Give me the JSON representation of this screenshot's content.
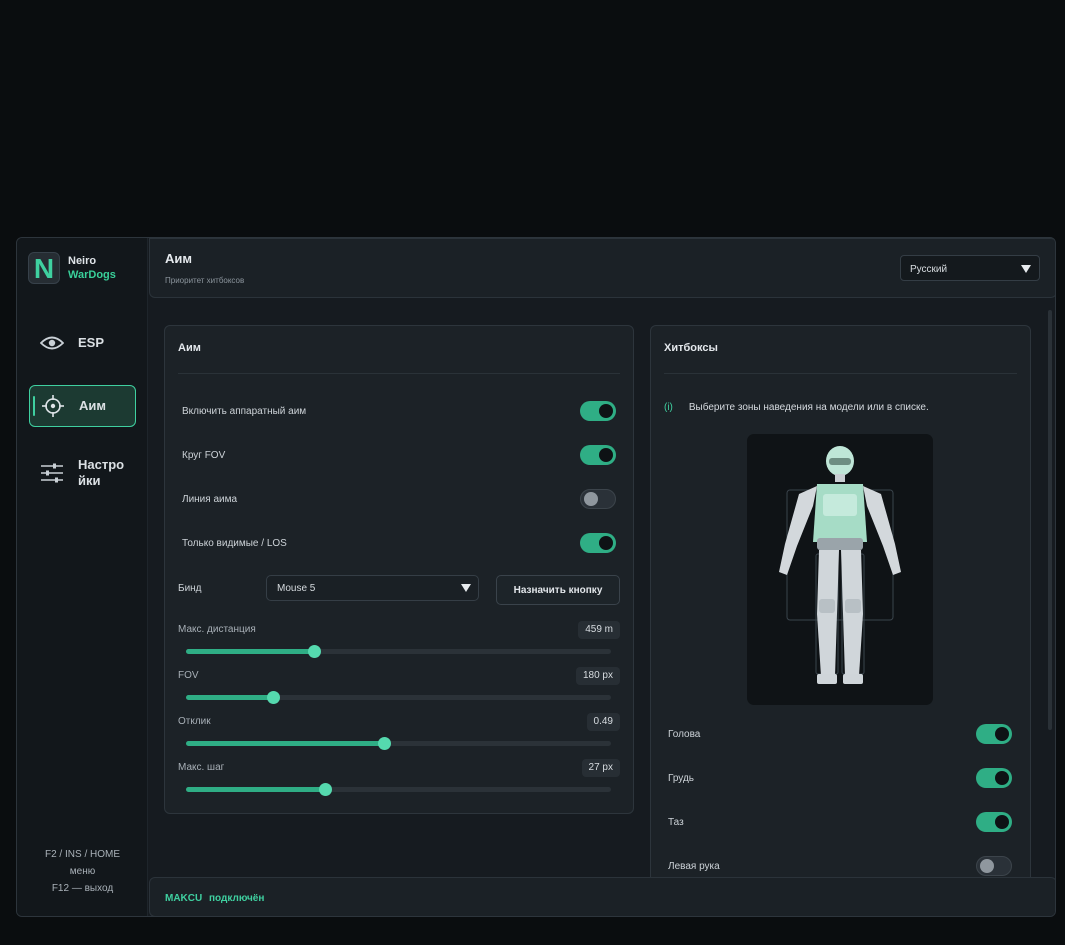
{
  "brand": {
    "logo_letter": "N",
    "line1": "Neiro",
    "line2": "WarDogs"
  },
  "sidebar": {
    "items": [
      {
        "label": "ESP",
        "icon": "eye-icon"
      },
      {
        "label": "Аим",
        "icon": "crosshair-icon",
        "active": true
      },
      {
        "label": "Настро\nйки",
        "icon": "sliders-icon"
      }
    ],
    "hotkeys": [
      "F2 / INS / HOME",
      "меню",
      "F12 — выход"
    ]
  },
  "header": {
    "title": "Аим",
    "subtitle": "Приоритет хитбоксов",
    "language": "Русский"
  },
  "aim_panel": {
    "title": "Аим",
    "toggles": [
      {
        "label": "Включить аппаратный аим",
        "on": true
      },
      {
        "label": "Круг FOV",
        "on": true
      },
      {
        "label": "Линия аима",
        "on": false
      },
      {
        "label": "Только видимые / LOS",
        "on": true
      }
    ],
    "bind": {
      "label": "Бинд",
      "value": "Mouse 5",
      "assign_button": "Назначить кнопку"
    },
    "sliders": [
      {
        "label": "Макс. дистанция",
        "value": "459 m",
        "fraction": 0.3
      },
      {
        "label": "FOV",
        "value": "180 px",
        "fraction": 0.205
      },
      {
        "label": "Отклик",
        "value": "0.49",
        "fraction": 0.465
      },
      {
        "label": "Макс. шаг",
        "value": "27 px",
        "fraction": 0.328
      }
    ]
  },
  "hitbox_panel": {
    "title": "Хитбоксы",
    "info_marker": "(i)",
    "info_text": "Выберите зоны наведения на модели или в списке.",
    "items": [
      {
        "label": "Голова",
        "on": true
      },
      {
        "label": "Грудь",
        "on": true
      },
      {
        "label": "Таз",
        "on": true
      },
      {
        "label": "Левая рука",
        "on": false
      }
    ]
  },
  "status": {
    "device": "MAKCU",
    "state": "подключён"
  },
  "colors": {
    "accent": "#3fd0a0",
    "toggle_on": "#2fae85",
    "background": "#161b20"
  }
}
